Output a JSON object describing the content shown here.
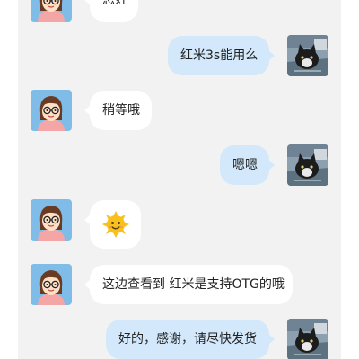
{
  "colors": {
    "background": "#f2f2f2",
    "bubble_incoming": "#ffffff",
    "bubble_outgoing": "#d3e9fb",
    "agent_avatar_bg": "#7fbde8"
  },
  "messages": [
    {
      "side": "left",
      "text": "您好",
      "avatar": "agent-avatar-icon"
    },
    {
      "side": "right",
      "text": "红米3s能用么",
      "avatar": "cat-avatar-icon"
    },
    {
      "side": "left",
      "text": "稍等哦",
      "avatar": "agent-avatar-icon"
    },
    {
      "side": "right",
      "text": "嗯嗯",
      "avatar": "cat-avatar-icon"
    },
    {
      "side": "left",
      "text": "",
      "emoji": "smiling-sun-emoji-icon",
      "avatar": "agent-avatar-icon"
    },
    {
      "side": "left",
      "text": "这边查看到 红米是支持OTG的哦",
      "avatar": "agent-avatar-icon"
    },
    {
      "side": "right",
      "text": "好的，感谢，请尽快发货",
      "avatar": "cat-avatar-icon"
    }
  ]
}
